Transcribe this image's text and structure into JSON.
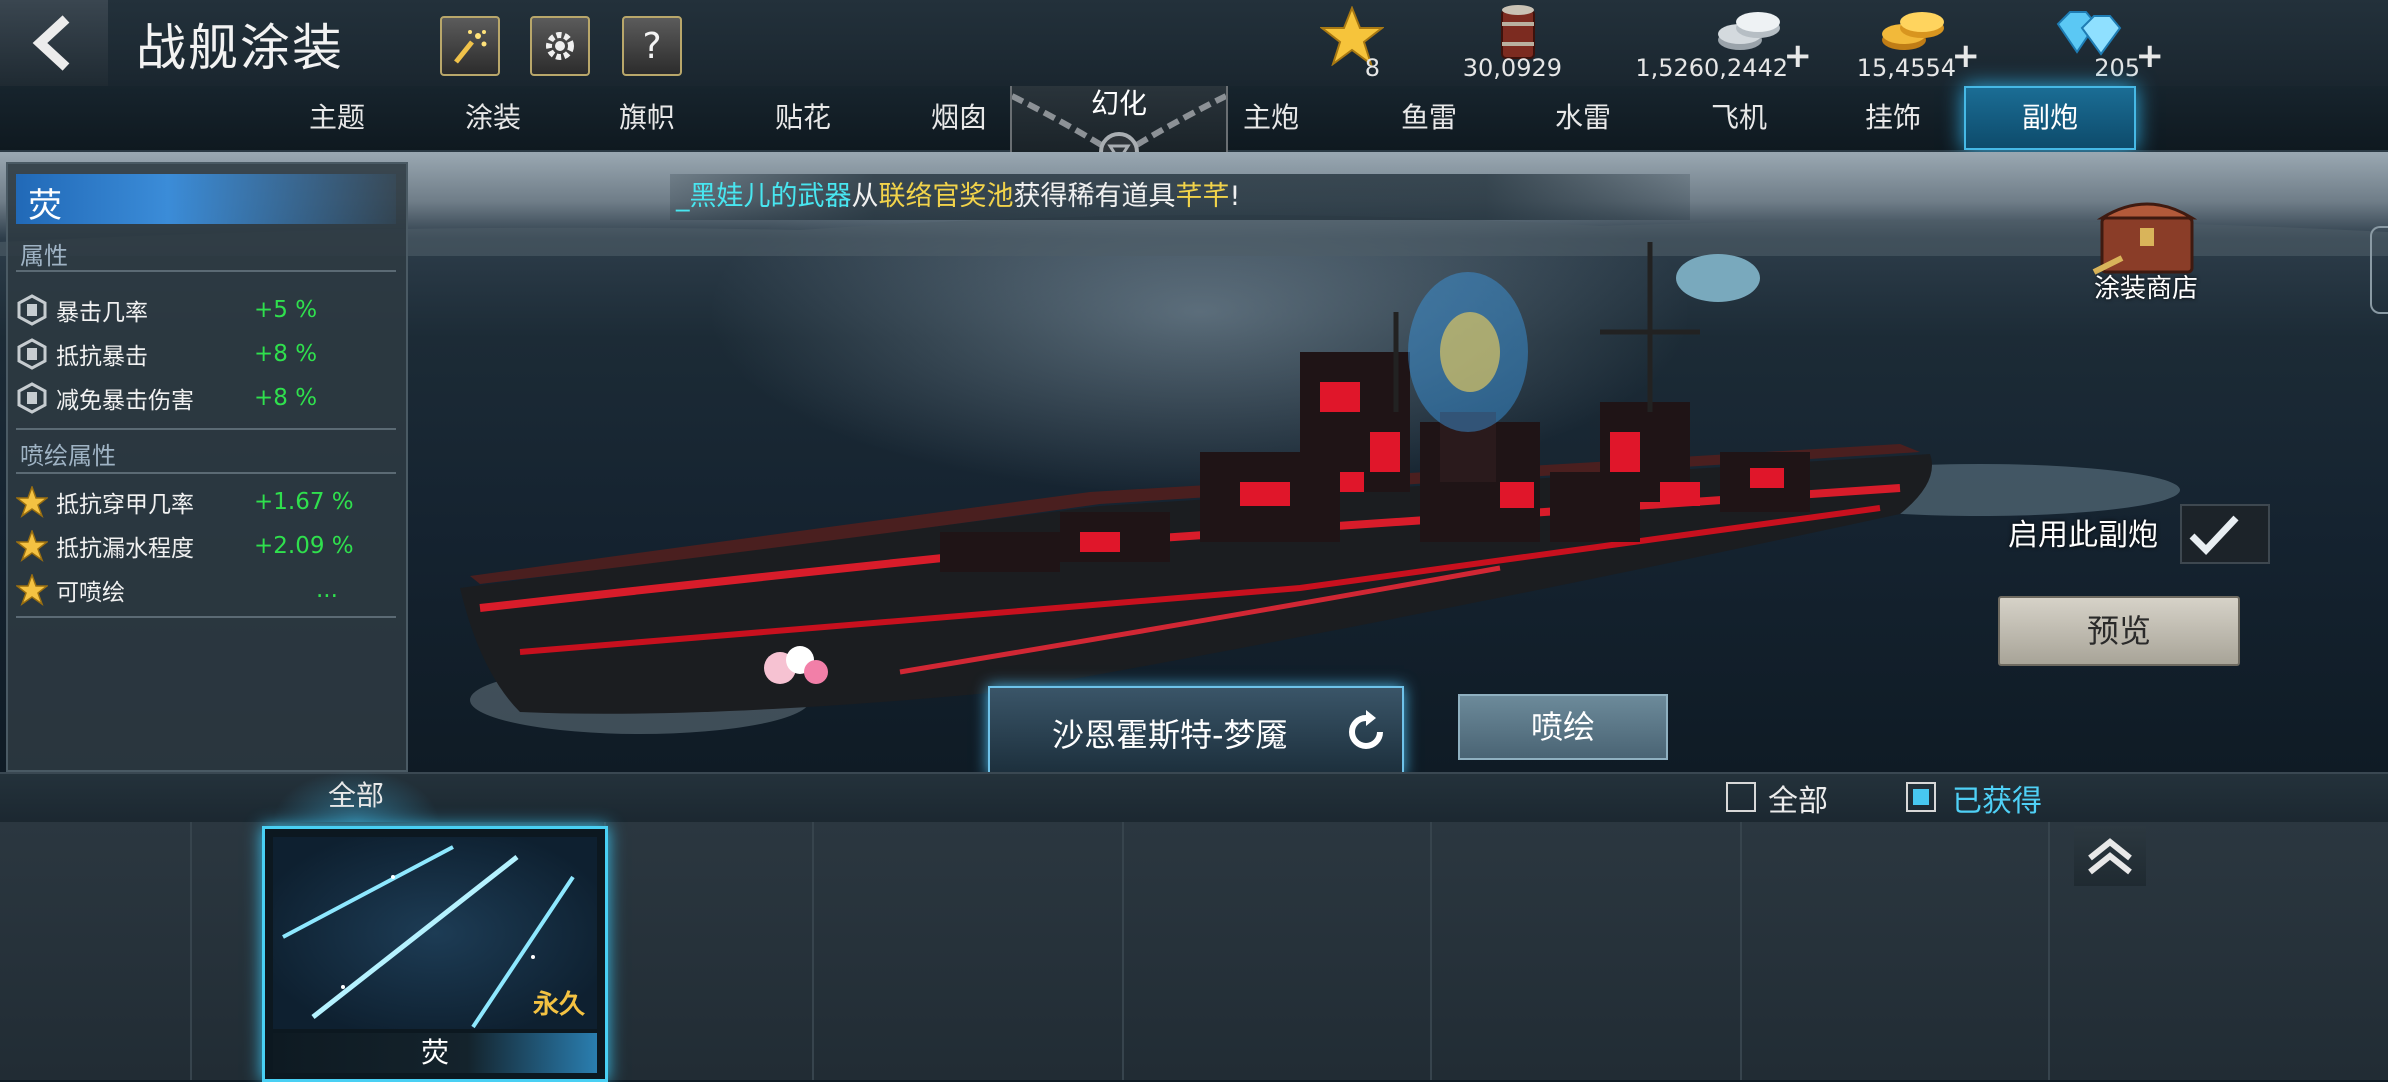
{
  "header": {
    "title": "战舰涂装",
    "help_label": "?"
  },
  "resources": [
    {
      "icon": "star-icon",
      "value": "8",
      "show_plus": false
    },
    {
      "icon": "oil-barrel-icon",
      "value": "30,0929",
      "show_plus": false
    },
    {
      "icon": "silver-coins-icon",
      "value": "1,5260,2442",
      "show_plus": true
    },
    {
      "icon": "gold-coins-icon",
      "value": "15,4554",
      "show_plus": true
    },
    {
      "icon": "diamond-icon",
      "value": "205",
      "show_plus": true
    }
  ],
  "plus_label": "+",
  "tabs": [
    "主题",
    "涂装",
    "旗帜",
    "贴花",
    "烟囱",
    "幻化",
    "主炮",
    "鱼雷",
    "水雷",
    "飞机",
    "挂饰",
    "副炮"
  ],
  "active_tab": "副炮",
  "left_panel": {
    "skin_name": "荧",
    "attributes_title": "属性",
    "attributes": [
      {
        "label": "暴击几率",
        "value": "+5 %"
      },
      {
        "label": "抵抗暴击",
        "value": "+8 %"
      },
      {
        "label": "减免暴击伤害",
        "value": "+8 %"
      }
    ],
    "spray_title": "喷绘属性",
    "spray_attributes": [
      {
        "label": "抵抗穿甲几率",
        "value": "+1.67 %"
      },
      {
        "label": "抵抗漏水程度",
        "value": "+2.09 %"
      },
      {
        "label": "可喷绘",
        "value": "..."
      }
    ]
  },
  "notice": {
    "player": "_黑娃儿的武器",
    "part1": "从",
    "pool": "联络官奖池",
    "part2": "获得稀有道具",
    "item": "芊芊",
    "part3": "!"
  },
  "shop": {
    "label": "涂装商店"
  },
  "enable_label": "启用此副炮",
  "preview_label": "预览",
  "ship_name": "沙恩霍斯特-梦魇",
  "spray_label": "喷绘",
  "filter": {
    "category_tab": "全部",
    "option_all": "全部",
    "option_owned": "已获得"
  },
  "card": {
    "name": "荧",
    "duration": "永久"
  },
  "colors": {
    "accent": "#46b9e6",
    "positive": "#2fe04d",
    "gold": "#f4c242",
    "notice_player": "#48e6f0",
    "notice_pool": "#f2d34a"
  }
}
